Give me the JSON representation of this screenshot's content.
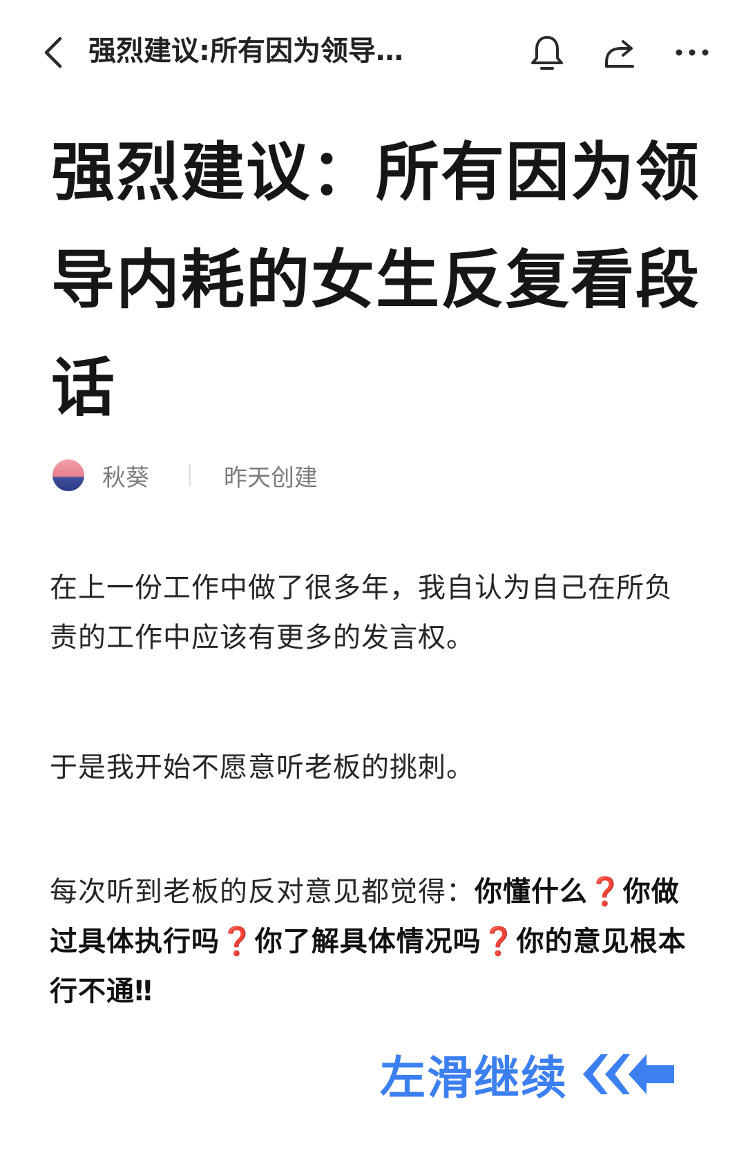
{
  "header": {
    "title": "强烈建议:所有因为领导…",
    "back_icon": "back-chevron-icon",
    "bell_icon": "bell-icon",
    "share_icon": "share-icon",
    "more_icon": "more-dots-icon"
  },
  "article": {
    "title": "强烈建议：所有因为领导内耗的女生反复看段话",
    "author": "秋葵",
    "created": "昨天创建",
    "paragraphs": {
      "p1": "在上一份工作中做了很多年，我自认为自己在所负责的工作中应该有更多的发言权。",
      "p2": "于是我开始不愿意听老板的挑刺。",
      "p3_lead": "每次听到老板的反对意见都觉得：",
      "p3_q1": "你懂什么",
      "p3_q2": "你做过具体执行吗",
      "p3_q3": "你了解具体情况吗",
      "p3_q4_start": "你的意见根本行不通",
      "p3_end": "‼",
      "qmark": "❓"
    }
  },
  "footer": {
    "swipe_label": "左滑继续",
    "swipe_icon": "double-left-arrow-icon"
  },
  "colors": {
    "accent_blue": "#3b7ff0",
    "question_red": "#e53935"
  }
}
